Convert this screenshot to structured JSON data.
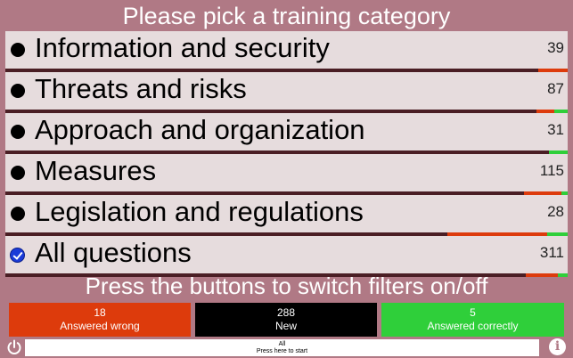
{
  "title": "Please pick a training category",
  "categories": [
    {
      "label": "Information and security",
      "count": "39",
      "selected": false
    },
    {
      "label": "Threats and risks",
      "count": "87",
      "selected": false
    },
    {
      "label": "Approach and organization",
      "count": "31",
      "selected": false
    },
    {
      "label": "Measures",
      "count": "115",
      "selected": false
    },
    {
      "label": "Legislation and regulations",
      "count": "28",
      "selected": false
    },
    {
      "label": "All questions",
      "count": "311",
      "selected": true
    }
  ],
  "filter_hint": "Press the buttons to switch filters on/off",
  "filters": {
    "wrong": {
      "count": "18",
      "label": "Answered wrong",
      "color": "#dd3b0c"
    },
    "new": {
      "count": "288",
      "label": "New",
      "color": "#000000"
    },
    "correct": {
      "count": "5",
      "label": "Answered correctly",
      "color": "#2fcf3a"
    }
  },
  "start": {
    "line1": "All",
    "line2": "Press here to start"
  },
  "icons": {
    "power": "power-icon",
    "info": "info-icon"
  },
  "colors": {
    "background": "#b07985",
    "row": "#e6dcdd",
    "bar_dark": "#4a1e24",
    "bar_red": "#dd3b0c",
    "bar_green": "#2fcf3a"
  }
}
